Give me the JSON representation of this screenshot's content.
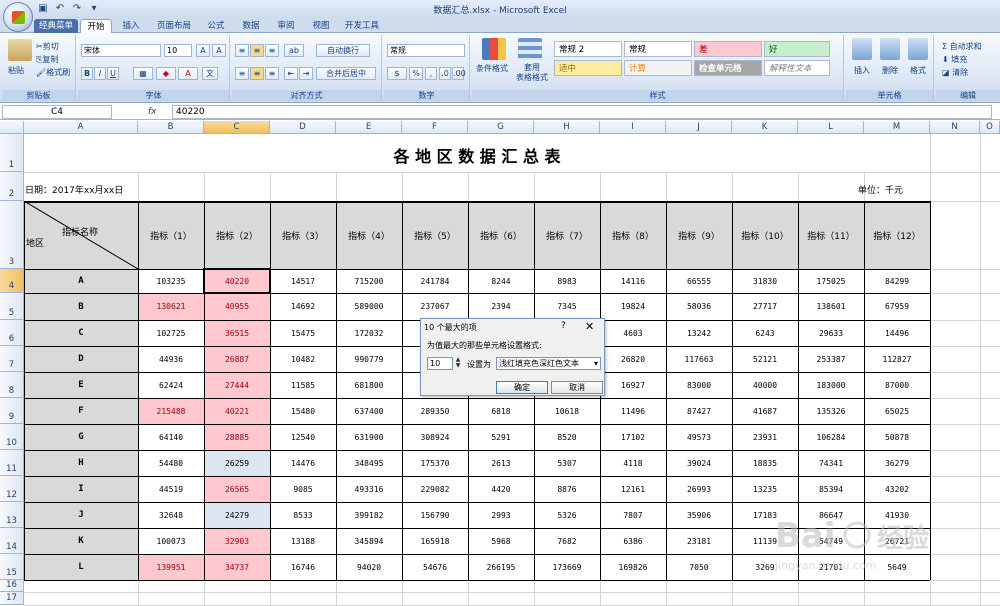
{
  "window": {
    "title": "数据汇总.xlsx - Microsoft Excel"
  },
  "tabs": [
    "经典菜单",
    "开始",
    "插入",
    "页面布局",
    "公式",
    "数据",
    "审阅",
    "视图",
    "开发工具"
  ],
  "ribbon": {
    "clipboard": {
      "paste": "粘贴",
      "cut": "剪切",
      "copy": "复制",
      "format_painter": "格式刷",
      "label": "剪贴板"
    },
    "font": {
      "name": "宋体",
      "size": "10",
      "label": "字体",
      "bold": "B",
      "italic": "I",
      "underline": "U",
      "wen": "文"
    },
    "alignment": {
      "wrap": "自动换行",
      "merge": "合并后居中",
      "label": "对齐方式"
    },
    "number": {
      "format": "常规",
      "percent": "%",
      "comma": ",",
      "label": "数字"
    },
    "styles": {
      "conditional": "条件格式",
      "table": "套用\n表格格式",
      "label": "样式",
      "cells": [
        {
          "text": "常规 2",
          "bg": "#ffffff",
          "fg": "#000000"
        },
        {
          "text": "常规",
          "bg": "#ffffff",
          "fg": "#000000"
        },
        {
          "text": "差",
          "bg": "#ffc7ce",
          "fg": "#9c0006"
        },
        {
          "text": "好",
          "bg": "#c6efce",
          "fg": "#006100"
        },
        {
          "text": "适中",
          "bg": "#ffeb9c",
          "fg": "#9c6500"
        },
        {
          "text": "计算",
          "bg": "#f2f2f2",
          "fg": "#fa7d00"
        },
        {
          "text": "检查单元格",
          "bg": "#a5a5a5",
          "fg": "#ffffff"
        },
        {
          "text": "解释性文本",
          "bg": "#ffffff",
          "fg": "#7f7f7f"
        }
      ]
    },
    "cells": {
      "insert": "插入",
      "delete": "删除",
      "format": "格式",
      "label": "单元格"
    },
    "editing": {
      "autosum": "Σ 自动求和",
      "fill": "填充",
      "clear": "清除",
      "label": "编辑"
    }
  },
  "formula_bar": {
    "name_box": "C4",
    "fx": "fx",
    "content": "40220"
  },
  "columns": [
    "A",
    "B",
    "C",
    "D",
    "E",
    "F",
    "G",
    "H",
    "I",
    "J",
    "K",
    "L",
    "M",
    "N",
    "O"
  ],
  "selected_column": "C",
  "sheet": {
    "title": "各 地 区 数 据 汇 总 表",
    "date": "日期：2017年xx月xx日",
    "unit": "单位：千元",
    "diag_top": "指标名称",
    "diag_bottom": "地区",
    "headers": [
      "指标（1）",
      "指标（2）",
      "指标（3）",
      "指标（4）",
      "指标（5）",
      "指标（6）",
      "指标（7）",
      "指标（8）",
      "指标（9）",
      "指标（10）",
      "指标（11）",
      "指标（12）"
    ],
    "rows": [
      {
        "name": "A",
        "values": [
          "103235",
          "40220",
          "14517",
          "715200",
          "241784",
          "8244",
          "8983",
          "14116",
          "66555",
          "31830",
          "175025",
          "84299"
        ]
      },
      {
        "name": "B",
        "values": [
          "130621",
          "40955",
          "14692",
          "589000",
          "237067",
          "2394",
          "7345",
          "19824",
          "58036",
          "27717",
          "138601",
          "67959"
        ]
      },
      {
        "name": "C",
        "values": [
          "102725",
          "36515",
          "15475",
          "172032",
          "",
          "",
          "",
          "4603",
          "13242",
          "6243",
          "29633",
          "14496"
        ]
      },
      {
        "name": "D",
        "values": [
          "44936",
          "26887",
          "10482",
          "990779",
          "",
          "",
          "",
          "26820",
          "117663",
          "52121",
          "253387",
          "112827"
        ]
      },
      {
        "name": "E",
        "values": [
          "62424",
          "27444",
          "11585",
          "681800",
          "",
          "",
          "",
          "16927",
          "83000",
          "40000",
          "183000",
          "87000"
        ]
      },
      {
        "name": "F",
        "values": [
          "215488",
          "40221",
          "15480",
          "637400",
          "289350",
          "6818",
          "10618",
          "11496",
          "87427",
          "41687",
          "135326",
          "65025"
        ]
      },
      {
        "name": "G",
        "values": [
          "64140",
          "28885",
          "12540",
          "631900",
          "308924",
          "5291",
          "8520",
          "17102",
          "49573",
          "23931",
          "106284",
          "50878"
        ]
      },
      {
        "name": "H",
        "values": [
          "54480",
          "26259",
          "14476",
          "348495",
          "175370",
          "2613",
          "5307",
          "4118",
          "39024",
          "18835",
          "74341",
          "36279"
        ]
      },
      {
        "name": "I",
        "values": [
          "44519",
          "26565",
          "9085",
          "493316",
          "229082",
          "4420",
          "8876",
          "12161",
          "26993",
          "13235",
          "85394",
          "43202"
        ]
      },
      {
        "name": "J",
        "values": [
          "32648",
          "24279",
          "8533",
          "399182",
          "156790",
          "2993",
          "5326",
          "7807",
          "35906",
          "17183",
          "86647",
          "41930"
        ]
      },
      {
        "name": "K",
        "values": [
          "100073",
          "32903",
          "13188",
          "345894",
          "165918",
          "5968",
          "7682",
          "6386",
          "23181",
          "11139",
          "54749",
          "26721"
        ]
      },
      {
        "name": "L",
        "values": [
          "139951",
          "34737",
          "16746",
          "94020",
          "54676",
          "266195",
          "173669",
          "169826",
          "7050",
          "3269",
          "21701",
          "5649"
        ]
      }
    ],
    "row_numbers": [
      "1",
      "2",
      "3",
      "4",
      "5",
      "6",
      "7",
      "8",
      "9",
      "10",
      "11",
      "12",
      "13",
      "14",
      "15",
      "16",
      "17"
    ],
    "highlight_b_rows": [
      1,
      5,
      11
    ]
  },
  "dialog": {
    "title": "10 个最大的项",
    "help": "?",
    "close": "✕",
    "prompt": "为值最大的那些单元格设置格式:",
    "count": "10",
    "set_as": "设置为",
    "style": "浅红填充色深红色文本",
    "ok": "确定",
    "cancel": "取消"
  },
  "watermark": {
    "text": "Bai 经验",
    "sub": "jingyan.baidu.com"
  }
}
